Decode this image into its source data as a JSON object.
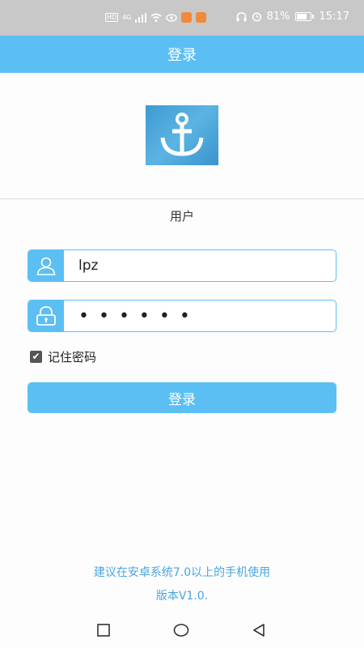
{
  "status_bar": {
    "network_labels": [
      "HD",
      "4G"
    ],
    "battery_percent": "81%",
    "battery_level": 0.81,
    "time": "15:17"
  },
  "header": {
    "title": "登录"
  },
  "logo": {
    "icon": "anchor-icon"
  },
  "login_form": {
    "user_label": "用户",
    "username": {
      "value": "lpz",
      "icon": "user-icon"
    },
    "password": {
      "value": "••••••",
      "icon": "lock-icon"
    },
    "remember": {
      "label": "记住密码",
      "checked": true
    },
    "submit_label": "登录"
  },
  "footer": {
    "note": "建议在安卓系统7.0以上的手机使用",
    "version": "版本V1.0."
  },
  "colors": {
    "accent": "#5bbff4",
    "footer_text": "#4aa6df"
  },
  "nav": {
    "icons": [
      "recent-apps-icon",
      "home-icon",
      "back-icon"
    ]
  }
}
